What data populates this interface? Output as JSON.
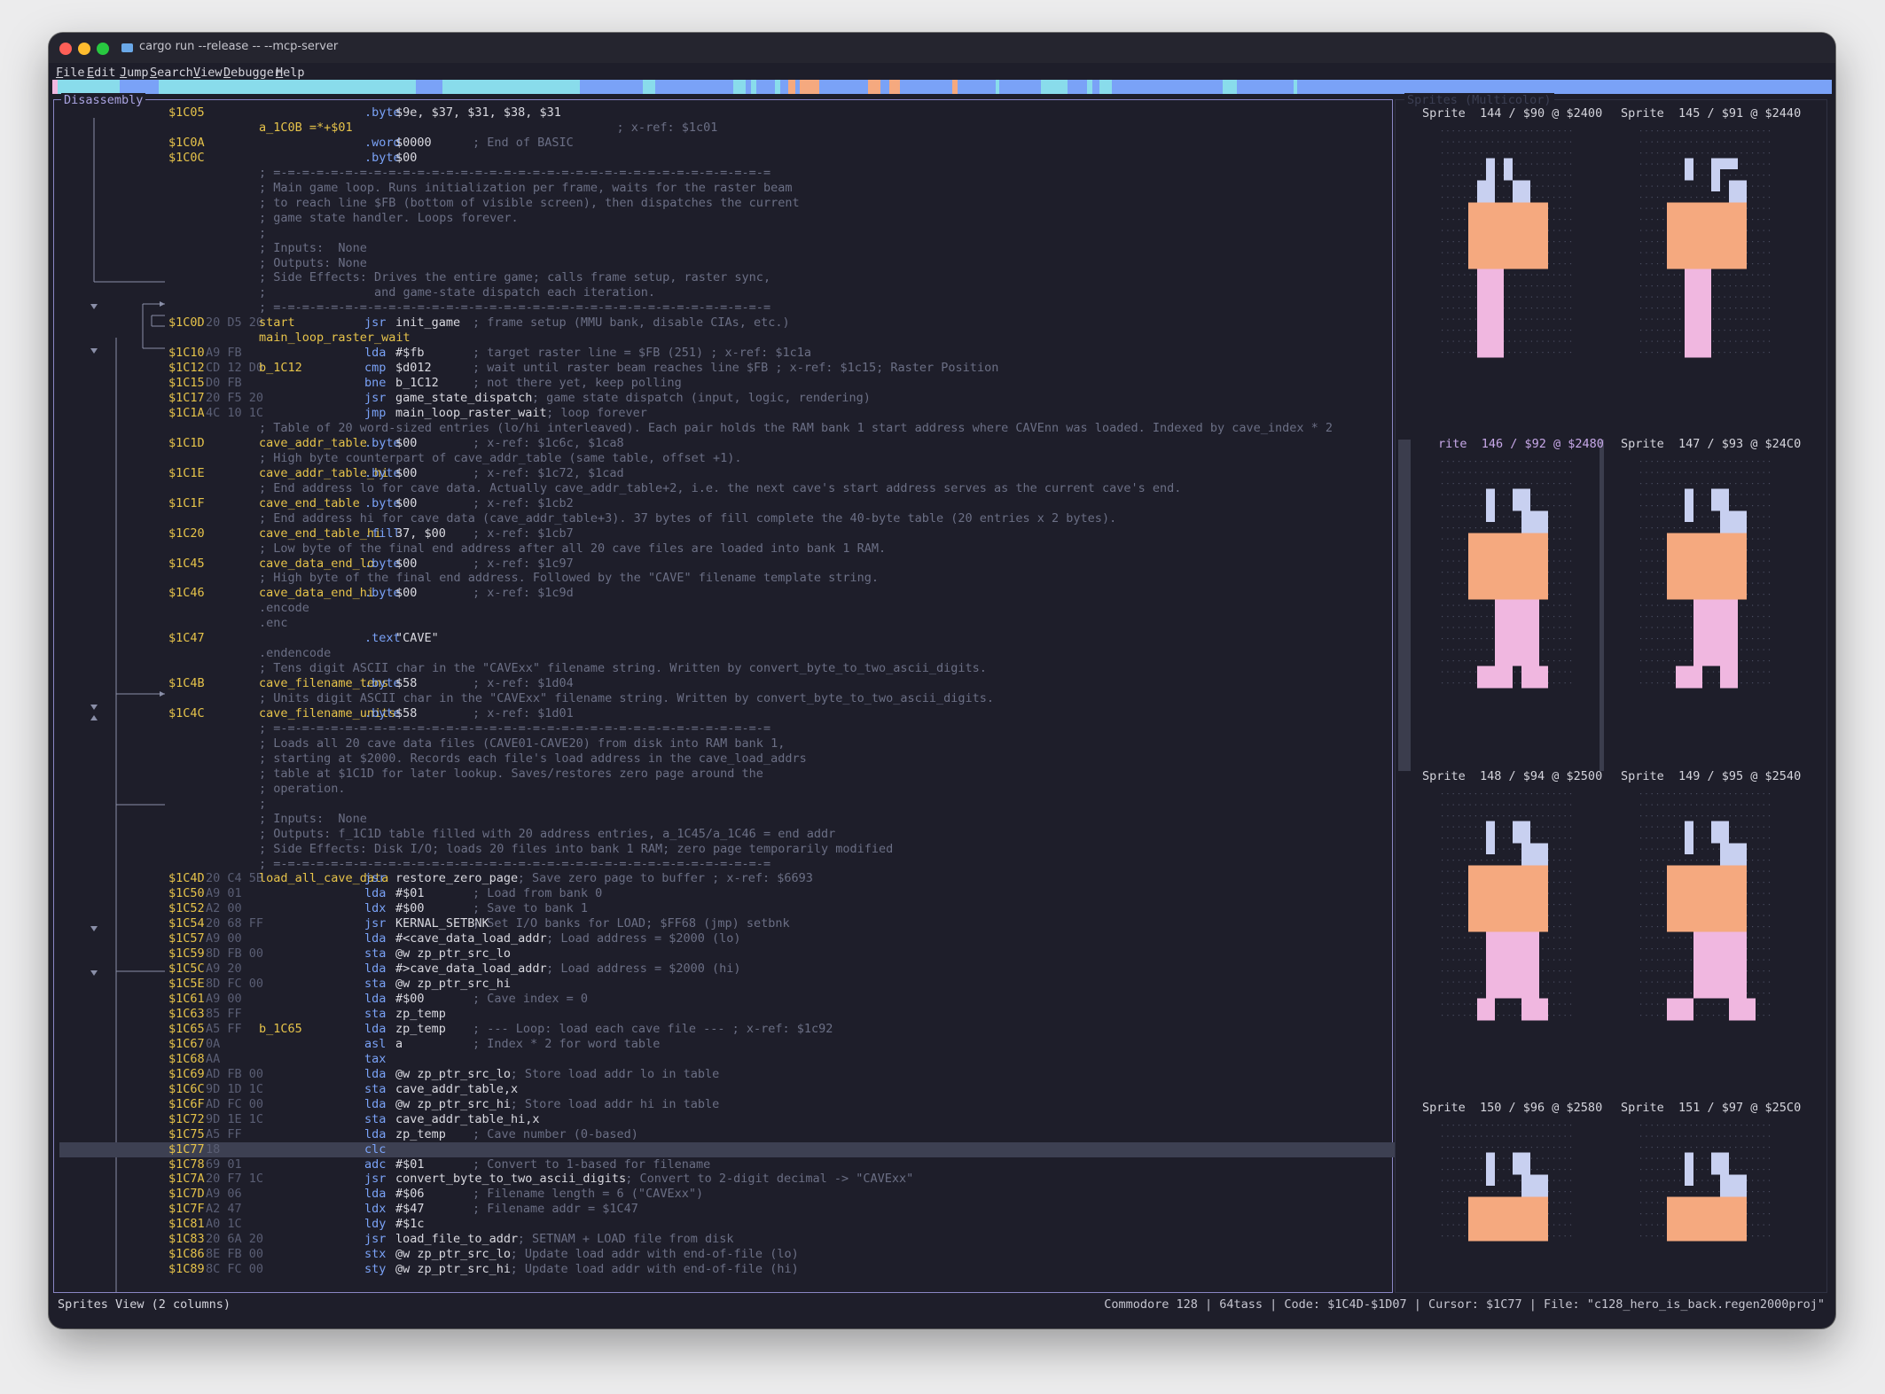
{
  "window": {
    "title": "cargo run --release -- --mcp-server"
  },
  "menu": [
    {
      "label": "File",
      "u": "F",
      "rest": "ile"
    },
    {
      "label": "Edit",
      "u": "E",
      "rest": "dit"
    },
    {
      "label": "Jump",
      "u": "J",
      "rest": "ump"
    },
    {
      "label": "Search",
      "u": "S",
      "rest": "earch"
    },
    {
      "label": "View",
      "u": "V",
      "rest": "iew"
    },
    {
      "label": "Debugger",
      "u": "D",
      "rest": "ebugger"
    },
    {
      "label": "Help",
      "u": "H",
      "rest": "elp"
    }
  ],
  "colors": {
    "code": "#7aa2f7",
    "data": "#89dceb",
    "pointer": "#f5a97f",
    "text": "#f0b7e0",
    "sprite_hi": "#c8d0f0",
    "sprite_mid": "#f5a97f",
    "sprite_lo": "#f0b7e0"
  },
  "disassembly": {
    "title": "Disassembly",
    "lines": [
      {
        "addr": "$1C05",
        "bytes": "",
        "label": "",
        "mnem": ".byte",
        "oper": "$9e, $37, $31, $38, $31",
        "cmt": ""
      },
      {
        "addr": "",
        "bytes": "",
        "label": "a_1C0B =*+$01",
        "mnem": "",
        "oper": "",
        "cmt": "                    ; x-ref: $1c01"
      },
      {
        "addr": "$1C0A",
        "bytes": "",
        "label": "",
        "mnem": ".word",
        "oper": "$0000",
        "cmt": "; End of BASIC"
      },
      {
        "addr": "$1C0C",
        "bytes": "",
        "label": "",
        "mnem": ".byte",
        "oper": "$00",
        "cmt": ""
      },
      {
        "addr": "",
        "bytes": "",
        "label": "",
        "mnem": "",
        "oper": "",
        "cmt": "; =-=-=-=-=-=-=-=-=-=-=-=-=-=-=-=-=-=-=-=-=-=-=-=-=-=-=-=-=-=-=-=-=-=-="
      },
      {
        "addr": "",
        "bytes": "",
        "label": "",
        "mnem": "",
        "oper": "",
        "cmt": "; Main game loop. Runs initialization per frame, waits for the raster beam"
      },
      {
        "addr": "",
        "bytes": "",
        "label": "",
        "mnem": "",
        "oper": "",
        "cmt": "; to reach line $FB (bottom of visible screen), then dispatches the current"
      },
      {
        "addr": "",
        "bytes": "",
        "label": "",
        "mnem": "",
        "oper": "",
        "cmt": "; game state handler. Loops forever."
      },
      {
        "addr": "",
        "bytes": "",
        "label": "",
        "mnem": "",
        "oper": "",
        "cmt": ";"
      },
      {
        "addr": "",
        "bytes": "",
        "label": "",
        "mnem": "",
        "oper": "",
        "cmt": "; Inputs:  None"
      },
      {
        "addr": "",
        "bytes": "",
        "label": "",
        "mnem": "",
        "oper": "",
        "cmt": "; Outputs: None"
      },
      {
        "addr": "",
        "bytes": "",
        "label": "",
        "mnem": "",
        "oper": "",
        "cmt": "; Side Effects: Drives the entire game; calls frame setup, raster sync,"
      },
      {
        "addr": "",
        "bytes": "",
        "label": "",
        "mnem": "",
        "oper": "",
        "cmt": ";               and game-state dispatch each iteration."
      },
      {
        "addr": "",
        "bytes": "",
        "label": "",
        "mnem": "",
        "oper": "",
        "cmt": "; =-=-=-=-=-=-=-=-=-=-=-=-=-=-=-=-=-=-=-=-=-=-=-=-=-=-=-=-=-=-=-=-=-=-="
      },
      {
        "addr": "$1C0D",
        "bytes": "20 D5 20",
        "label": "start",
        "mnem": "jsr",
        "oper": "init_game",
        "cmt": "; frame setup (MMU bank, disable CIAs, etc.)"
      },
      {
        "addr": "",
        "bytes": "",
        "label": "main_loop_raster_wait",
        "mnem": "",
        "oper": "",
        "cmt": ""
      },
      {
        "addr": "$1C10",
        "bytes": "A9 FB",
        "label": "",
        "mnem": "lda",
        "oper": "#$fb",
        "cmt": "; target raster line = $FB (251) ; x-ref: $1c1a"
      },
      {
        "addr": "$1C12",
        "bytes": "CD 12 D0",
        "label": "b_1C12",
        "mnem": "cmp",
        "oper": "$d012",
        "cmt": "; wait until raster beam reaches line $FB ; x-ref: $1c15; Raster Position"
      },
      {
        "addr": "$1C15",
        "bytes": "D0 FB",
        "label": "",
        "mnem": "bne",
        "oper": "b_1C12",
        "cmt": "; not there yet, keep polling"
      },
      {
        "addr": "$1C17",
        "bytes": "20 F5 20",
        "label": "",
        "mnem": "jsr",
        "oper": "game_state_dispatch",
        "cmt": "; game state dispatch (input, logic, rendering)"
      },
      {
        "addr": "$1C1A",
        "bytes": "4C 10 1C",
        "label": "",
        "mnem": "jmp",
        "oper": "main_loop_raster_wait",
        "cmt": "; loop forever"
      },
      {
        "addr": "",
        "bytes": "",
        "label": "",
        "mnem": "",
        "oper": "",
        "cmt": "; Table of 20 word-sized entries (lo/hi interleaved). Each pair holds the RAM bank 1 start address where CAVEnn was loaded. Indexed by cave_index * 2"
      },
      {
        "addr": "$1C1D",
        "bytes": "",
        "label": "cave_addr_table",
        "mnem": ".byte",
        "oper": "$00",
        "cmt": "; x-ref: $1c6c, $1ca8"
      },
      {
        "addr": "",
        "bytes": "",
        "label": "",
        "mnem": "",
        "oper": "",
        "cmt": "; High byte counterpart of cave_addr_table (same table, offset +1)."
      },
      {
        "addr": "$1C1E",
        "bytes": "",
        "label": "cave_addr_table_hi",
        "mnem": ".byte",
        "oper": "$00",
        "cmt": "; x-ref: $1c72, $1cad"
      },
      {
        "addr": "",
        "bytes": "",
        "label": "",
        "mnem": "",
        "oper": "",
        "cmt": "; End address lo for cave data. Actually cave_addr_table+2, i.e. the next cave's start address serves as the current cave's end."
      },
      {
        "addr": "$1C1F",
        "bytes": "",
        "label": "cave_end_table",
        "mnem": ".byte",
        "oper": "$00",
        "cmt": "; x-ref: $1cb2"
      },
      {
        "addr": "",
        "bytes": "",
        "label": "",
        "mnem": "",
        "oper": "",
        "cmt": "; End address hi for cave data (cave_addr_table+3). 37 bytes of fill complete the 40-byte table (20 entries x 2 bytes)."
      },
      {
        "addr": "$1C20",
        "bytes": "",
        "label": "cave_end_table_hi",
        "mnem": ".fill",
        "oper": "37, $00",
        "cmt": "; x-ref: $1cb7"
      },
      {
        "addr": "",
        "bytes": "",
        "label": "",
        "mnem": "",
        "oper": "",
        "cmt": "; Low byte of the final end address after all 20 cave files are loaded into bank 1 RAM."
      },
      {
        "addr": "$1C45",
        "bytes": "",
        "label": "cave_data_end_lo",
        "mnem": ".byte",
        "oper": "$00",
        "cmt": "; x-ref: $1c97"
      },
      {
        "addr": "",
        "bytes": "",
        "label": "",
        "mnem": "",
        "oper": "",
        "cmt": "; High byte of the final end address. Followed by the \"CAVE\" filename template string."
      },
      {
        "addr": "$1C46",
        "bytes": "",
        "label": "cave_data_end_hi",
        "mnem": ".byte",
        "oper": "$00",
        "cmt": "; x-ref: $1c9d"
      },
      {
        "addr": "",
        "bytes": "",
        "label": "",
        "mnem": "",
        "oper": "",
        "cmt": ".encode"
      },
      {
        "addr": "",
        "bytes": "",
        "label": "",
        "mnem": "",
        "oper": "",
        "cmt": ".enc"
      },
      {
        "addr": "$1C47",
        "bytes": "",
        "label": "",
        "mnem": ".text",
        "oper": "\"CAVE\"",
        "cmt": ""
      },
      {
        "addr": "",
        "bytes": "",
        "label": "",
        "mnem": "",
        "oper": "",
        "cmt": ".endencode"
      },
      {
        "addr": "",
        "bytes": "",
        "label": "",
        "mnem": "",
        "oper": "",
        "cmt": "; Tens digit ASCII char in the \"CAVExx\" filename string. Written by convert_byte_to_two_ascii_digits."
      },
      {
        "addr": "$1C4B",
        "bytes": "",
        "label": "cave_filename_tens",
        "mnem": ".byte",
        "oper": "$58",
        "cmt": "; x-ref: $1d04"
      },
      {
        "addr": "",
        "bytes": "",
        "label": "",
        "mnem": "",
        "oper": "",
        "cmt": "; Units digit ASCII char in the \"CAVExx\" filename string. Written by convert_byte_to_two_ascii_digits."
      },
      {
        "addr": "$1C4C",
        "bytes": "",
        "label": "cave_filename_units",
        "mnem": ".byte",
        "oper": "$58",
        "cmt": "; x-ref: $1d01"
      },
      {
        "addr": "",
        "bytes": "",
        "label": "",
        "mnem": "",
        "oper": "",
        "cmt": "; =-=-=-=-=-=-=-=-=-=-=-=-=-=-=-=-=-=-=-=-=-=-=-=-=-=-=-=-=-=-=-=-=-=-="
      },
      {
        "addr": "",
        "bytes": "",
        "label": "",
        "mnem": "",
        "oper": "",
        "cmt": "; Loads all 20 cave data files (CAVE01-CAVE20) from disk into RAM bank 1,"
      },
      {
        "addr": "",
        "bytes": "",
        "label": "",
        "mnem": "",
        "oper": "",
        "cmt": "; starting at $2000. Records each file's load address in the cave_load_addrs"
      },
      {
        "addr": "",
        "bytes": "",
        "label": "",
        "mnem": "",
        "oper": "",
        "cmt": "; table at $1C1D for later lookup. Saves/restores zero page around the"
      },
      {
        "addr": "",
        "bytes": "",
        "label": "",
        "mnem": "",
        "oper": "",
        "cmt": "; operation."
      },
      {
        "addr": "",
        "bytes": "",
        "label": "",
        "mnem": "",
        "oper": "",
        "cmt": ";"
      },
      {
        "addr": "",
        "bytes": "",
        "label": "",
        "mnem": "",
        "oper": "",
        "cmt": "; Inputs:  None"
      },
      {
        "addr": "",
        "bytes": "",
        "label": "",
        "mnem": "",
        "oper": "",
        "cmt": "; Outputs: f_1C1D table filled with 20 address entries, a_1C45/a_1C46 = end addr"
      },
      {
        "addr": "",
        "bytes": "",
        "label": "",
        "mnem": "",
        "oper": "",
        "cmt": "; Side Effects: Disk I/O; loads 20 files into bank 1 RAM; zero page temporarily modified"
      },
      {
        "addr": "",
        "bytes": "",
        "label": "",
        "mnem": "",
        "oper": "",
        "cmt": "; =-=-=-=-=-=-=-=-=-=-=-=-=-=-=-=-=-=-=-=-=-=-=-=-=-=-=-=-=-=-=-=-=-=-="
      },
      {
        "addr": "$1C4D",
        "bytes": "20 C4 5B",
        "label": "load_all_cave_data",
        "mnem": "jsr",
        "oper": "restore_zero_page",
        "cmt": "; Save zero page to buffer ; x-ref: $6693"
      },
      {
        "addr": "$1C50",
        "bytes": "A9 01",
        "label": "",
        "mnem": "lda",
        "oper": "#$01",
        "cmt": "; Load from bank 0"
      },
      {
        "addr": "$1C52",
        "bytes": "A2 00",
        "label": "",
        "mnem": "ldx",
        "oper": "#$00",
        "cmt": "; Save to bank 1"
      },
      {
        "addr": "$1C54",
        "bytes": "20 68 FF",
        "label": "",
        "mnem": "jsr",
        "oper": "KERNAL_SETBNK",
        "cmt": "; Set I/O banks for LOAD; $FF68 (jmp) setbnk"
      },
      {
        "addr": "$1C57",
        "bytes": "A9 00",
        "label": "",
        "mnem": "lda",
        "oper": "#<cave_data_load_addr",
        "cmt": "; Load address = $2000 (lo)"
      },
      {
        "addr": "$1C59",
        "bytes": "8D FB 00",
        "label": "",
        "mnem": "sta",
        "oper": "@w zp_ptr_src_lo",
        "cmt": ""
      },
      {
        "addr": "$1C5C",
        "bytes": "A9 20",
        "label": "",
        "mnem": "lda",
        "oper": "#>cave_data_load_addr",
        "cmt": "; Load address = $2000 (hi)"
      },
      {
        "addr": "$1C5E",
        "bytes": "8D FC 00",
        "label": "",
        "mnem": "sta",
        "oper": "@w zp_ptr_src_hi",
        "cmt": ""
      },
      {
        "addr": "$1C61",
        "bytes": "A9 00",
        "label": "",
        "mnem": "lda",
        "oper": "#$00",
        "cmt": "; Cave index = 0"
      },
      {
        "addr": "$1C63",
        "bytes": "85 FF",
        "label": "",
        "mnem": "sta",
        "oper": "zp_temp",
        "cmt": ""
      },
      {
        "addr": "$1C65",
        "bytes": "A5 FF",
        "label": "b_1C65",
        "mnem": "lda",
        "oper": "zp_temp",
        "cmt": "; --- Loop: load each cave file --- ; x-ref: $1c92"
      },
      {
        "addr": "$1C67",
        "bytes": "0A",
        "label": "",
        "mnem": "asl",
        "oper": "a",
        "cmt": "; Index * 2 for word table"
      },
      {
        "addr": "$1C68",
        "bytes": "AA",
        "label": "",
        "mnem": "tax",
        "oper": "",
        "cmt": ""
      },
      {
        "addr": "$1C69",
        "bytes": "AD FB 00",
        "label": "",
        "mnem": "lda",
        "oper": "@w zp_ptr_src_lo",
        "cmt": "; Store load addr lo in table"
      },
      {
        "addr": "$1C6C",
        "bytes": "9D 1D 1C",
        "label": "",
        "mnem": "sta",
        "oper": "cave_addr_table,x",
        "cmt": ""
      },
      {
        "addr": "$1C6F",
        "bytes": "AD FC 00",
        "label": "",
        "mnem": "lda",
        "oper": "@w zp_ptr_src_hi",
        "cmt": "; Store load addr hi in table"
      },
      {
        "addr": "$1C72",
        "bytes": "9D 1E 1C",
        "label": "",
        "mnem": "sta",
        "oper": "cave_addr_table_hi,x",
        "cmt": ""
      },
      {
        "addr": "$1C75",
        "bytes": "A5 FF",
        "label": "",
        "mnem": "lda",
        "oper": "zp_temp",
        "cmt": "; Cave number (0-based)"
      },
      {
        "addr": "$1C77",
        "bytes": "18",
        "label": "",
        "mnem": "clc",
        "oper": "",
        "cmt": "",
        "sel": true
      },
      {
        "addr": "$1C78",
        "bytes": "69 01",
        "label": "",
        "mnem": "adc",
        "oper": "#$01",
        "cmt": "; Convert to 1-based for filename"
      },
      {
        "addr": "$1C7A",
        "bytes": "20 F7 1C",
        "label": "",
        "mnem": "jsr",
        "oper": "convert_byte_to_two_ascii_digits",
        "cmt": "; Convert to 2-digit decimal -> \"CAVExx\""
      },
      {
        "addr": "$1C7D",
        "bytes": "A9 06",
        "label": "",
        "mnem": "lda",
        "oper": "#$06",
        "cmt": "; Filename length = 6 (\"CAVExx\")"
      },
      {
        "addr": "$1C7F",
        "bytes": "A2 47",
        "label": "",
        "mnem": "ldx",
        "oper": "#$47",
        "cmt": "; Filename addr = $1C47"
      },
      {
        "addr": "$1C81",
        "bytes": "A0 1C",
        "label": "",
        "mnem": "ldy",
        "oper": "#$1c",
        "cmt": ""
      },
      {
        "addr": "$1C83",
        "bytes": "20 6A 20",
        "label": "",
        "mnem": "jsr",
        "oper": "load_file_to_addr",
        "cmt": "; SETNAM + LOAD file from disk"
      },
      {
        "addr": "$1C86",
        "bytes": "8E FB 00",
        "label": "",
        "mnem": "stx",
        "oper": "@w zp_ptr_src_lo",
        "cmt": "; Update load addr with end-of-file (lo)"
      },
      {
        "addr": "$1C89",
        "bytes": "8C FC 00",
        "label": "",
        "mnem": "sty",
        "oper": "@w zp_ptr_src_hi",
        "cmt": "; Update load addr with end-of-file (hi)"
      }
    ]
  },
  "sprites": {
    "title": "Sprites (Multicolor)",
    "items": [
      {
        "label": "Sprite  144 / $90 @ $2400"
      },
      {
        "label": "Sprite  145 / $91 @ $2440"
      },
      {
        "label": "rite  146 / $92 @ $2480",
        "selected": true
      },
      {
        "label": "Sprite  147 / $93 @ $24C0"
      },
      {
        "label": "Sprite  148 / $94 @ $2500"
      },
      {
        "label": "Sprite  149 / $95 @ $2540"
      },
      {
        "label": "Sprite  150 / $96 @ $2580"
      },
      {
        "label": "Sprite  151 / $97 @ $25C0"
      }
    ]
  },
  "status": {
    "left": "Sprites View (2 columns)",
    "right": "Commodore 128 | 64tass | Code: $1C4D-$1D07 | Cursor: $1C77 | File: \"c128_hero_is_back.regen2000proj\""
  }
}
